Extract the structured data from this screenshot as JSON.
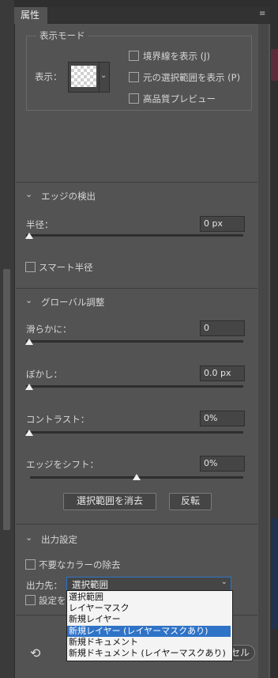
{
  "tab": {
    "label": "属性"
  },
  "view_mode": {
    "legend": "表示モード",
    "label": "表示：",
    "checkboxes": [
      {
        "label": "境界線を表示 (J)",
        "checked": false
      },
      {
        "label": "元の選択範囲を表示 (P)",
        "checked": false
      },
      {
        "label": "高品質プレビュー",
        "checked": false
      }
    ]
  },
  "edge": {
    "title": "エッジの検出",
    "radius_label": "半径：",
    "radius_value": "0 px",
    "radius_slider": 0,
    "smart_radius_label": "スマート半径",
    "smart_radius_checked": false
  },
  "global": {
    "title": "グローバル調整",
    "smooth_label": "滑らかに：",
    "smooth_value": "0",
    "smooth_slider": 0,
    "feather_label": "ぼかし：",
    "feather_value": "0.0 px",
    "feather_slider": 0,
    "contrast_label": "コントラスト：",
    "contrast_value": "0%",
    "contrast_slider": 0,
    "shift_label": "エッジをシフト：",
    "shift_value": "0%",
    "shift_slider": 0.5,
    "clear_button": "選択範囲を消去",
    "invert_button": "反転"
  },
  "output": {
    "title": "出力設定",
    "decontaminate_label": "不要なカラーの除去",
    "decontaminate_checked": false,
    "output_to_label": "出力先：",
    "output_to_value": "選択範囲",
    "options": [
      "選択範囲",
      "レイヤーマスク",
      "新規レイヤー",
      "新規レイヤー (レイヤーマスクあり)",
      "新規ドキュメント",
      "新規ドキュメント (レイヤーマスクあり)"
    ],
    "highlighted_option": "新規レイヤー (レイヤーマスクあり)",
    "remember_label_partial": "設定を",
    "remember_checked": false
  },
  "footer": {
    "cancel_partial": "セル"
  }
}
